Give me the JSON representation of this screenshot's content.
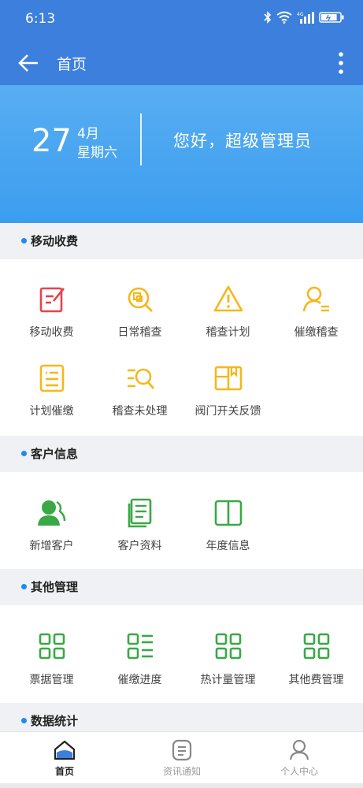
{
  "status": {
    "time": "6:13",
    "battery_level": 0.85
  },
  "appbar": {
    "title": "首页"
  },
  "hero": {
    "day": "27",
    "month": "4月",
    "weekday": "星期六",
    "greeting": "您好，超级管理员"
  },
  "sections": {
    "mobile_charge": {
      "title": "移动收费",
      "items": [
        {
          "label": "移动收费",
          "icon": "edit-doc-icon",
          "color": "#e8434a"
        },
        {
          "label": "日常稽查",
          "icon": "search-doc-icon",
          "color": "#f3b81b"
        },
        {
          "label": "稽查计划",
          "icon": "warning-icon",
          "color": "#f3b81b"
        },
        {
          "label": "催缴稽查",
          "icon": "person-list-icon",
          "color": "#f3b81b"
        },
        {
          "label": "计划催缴",
          "icon": "list-doc-icon",
          "color": "#f3b81b"
        },
        {
          "label": "稽查未处理",
          "icon": "list-search-icon",
          "color": "#f3b81b"
        },
        {
          "label": "阀门开关反馈",
          "icon": "book-icon",
          "color": "#f3b81b"
        }
      ]
    },
    "customer_info": {
      "title": "客户信息",
      "items": [
        {
          "label": "新增客户",
          "icon": "add-user-icon",
          "color": "#39a845"
        },
        {
          "label": "客户资料",
          "icon": "documents-icon",
          "color": "#39a845"
        },
        {
          "label": "年度信息",
          "icon": "open-book-icon",
          "color": "#39a845"
        }
      ]
    },
    "other_management": {
      "title": "其他管理",
      "items": [
        {
          "label": "票据管理",
          "icon": "grid-icon",
          "color": "#39a845"
        },
        {
          "label": "催缴进度",
          "icon": "grid-list-icon",
          "color": "#39a845"
        },
        {
          "label": "热计量管理",
          "icon": "grid-icon",
          "color": "#39a845"
        },
        {
          "label": "其他费管理",
          "icon": "grid-icon",
          "color": "#39a845"
        }
      ]
    },
    "data_stats": {
      "title": "数据统计"
    }
  },
  "tabs": [
    {
      "label": "首页",
      "icon": "home-icon",
      "active": true
    },
    {
      "label": "资讯通知",
      "icon": "news-icon",
      "active": false
    },
    {
      "label": "个人中心",
      "icon": "user-icon",
      "active": false
    }
  ],
  "colors": {
    "primary": "#3d7fdc",
    "accent_dot": "#1c8cf0",
    "red": "#e8434a",
    "yellow": "#f3b81b",
    "green": "#39a845"
  }
}
